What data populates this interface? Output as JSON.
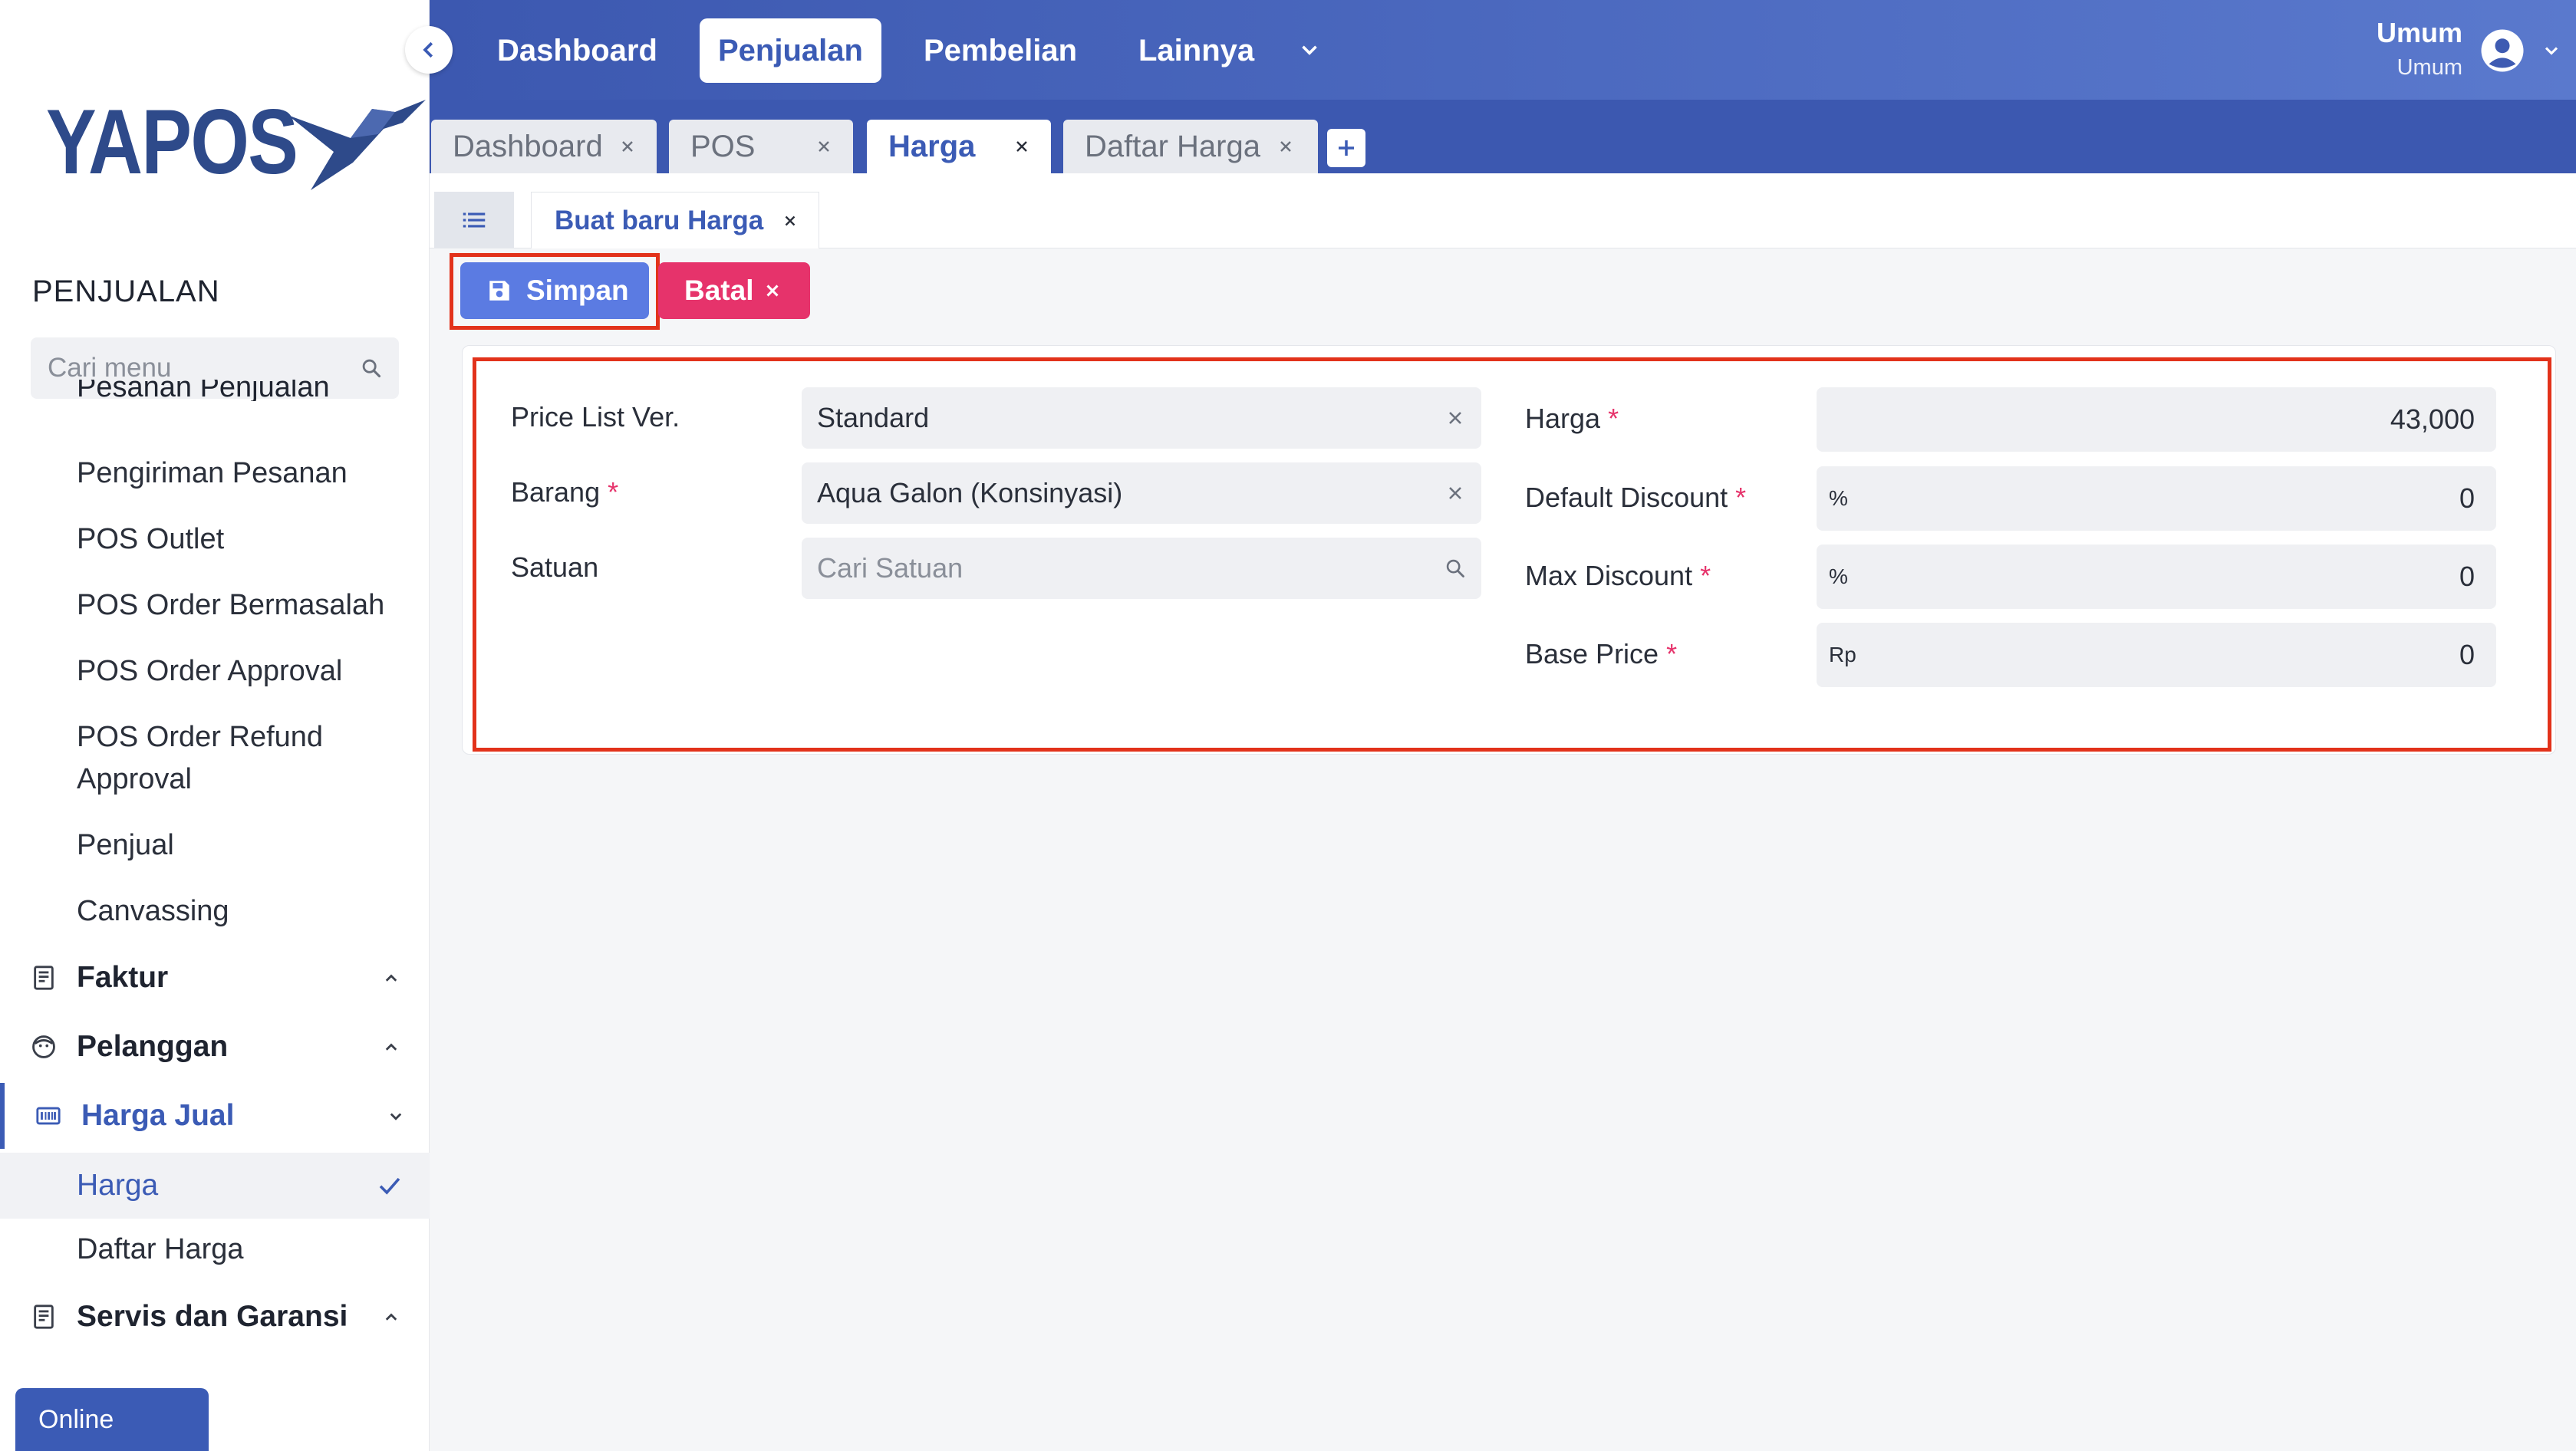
{
  "sidebar": {
    "logo_text": "YAPOS",
    "section_title": "PENJUALAN",
    "search_placeholder": "Cari menu",
    "cut_item": "Pesanan Penjualan",
    "items": [
      {
        "label": "Pengiriman Pesanan"
      },
      {
        "label": "POS Outlet"
      },
      {
        "label": "POS Order Bermasalah"
      },
      {
        "label": "POS Order Approval"
      },
      {
        "label": "POS Order Refund"
      },
      {
        "label": "Approval"
      },
      {
        "label": "Penjual"
      },
      {
        "label": "Canvassing"
      }
    ],
    "groups": {
      "faktur": "Faktur",
      "pelanggan": "Pelanggan",
      "harga_jual": "Harga Jual",
      "servis": "Servis dan Garansi"
    },
    "sub_active": "Harga",
    "sub_daftar": "Daftar Harga",
    "status": "Online"
  },
  "topnav": {
    "items": [
      "Dashboard",
      "Penjualan",
      "Pembelian",
      "Lainnya"
    ],
    "active": "Penjualan",
    "user_name": "Umum",
    "user_role": "Umum"
  },
  "tabs": [
    {
      "label": "Dashboard",
      "active": false
    },
    {
      "label": "POS",
      "active": false
    },
    {
      "label": "Harga",
      "active": true
    },
    {
      "label": "Daftar Harga",
      "active": false
    }
  ],
  "document_tab": "Buat baru Harga",
  "actions": {
    "save": "Simpan",
    "cancel": "Batal"
  },
  "form": {
    "price_list_label": "Price List Ver.",
    "price_list_value": "Standard",
    "barang_label": "Barang",
    "barang_value": "Aqua Galon (Konsinyasi)",
    "satuan_label": "Satuan",
    "satuan_placeholder": "Cari Satuan",
    "harga_label": "Harga",
    "harga_value": "43,000",
    "default_discount_label": "Default Discount",
    "default_discount_prefix": "%",
    "default_discount_value": "0",
    "max_discount_label": "Max Discount",
    "max_discount_prefix": "%",
    "max_discount_value": "0",
    "base_price_label": "Base Price",
    "base_price_prefix": "Rp",
    "base_price_value": "0",
    "required_mark": "*"
  },
  "colors": {
    "primary": "#3b5bb5",
    "save_button": "#5b7be2",
    "cancel_button": "#e6336b",
    "highlight": "#e2321b"
  }
}
